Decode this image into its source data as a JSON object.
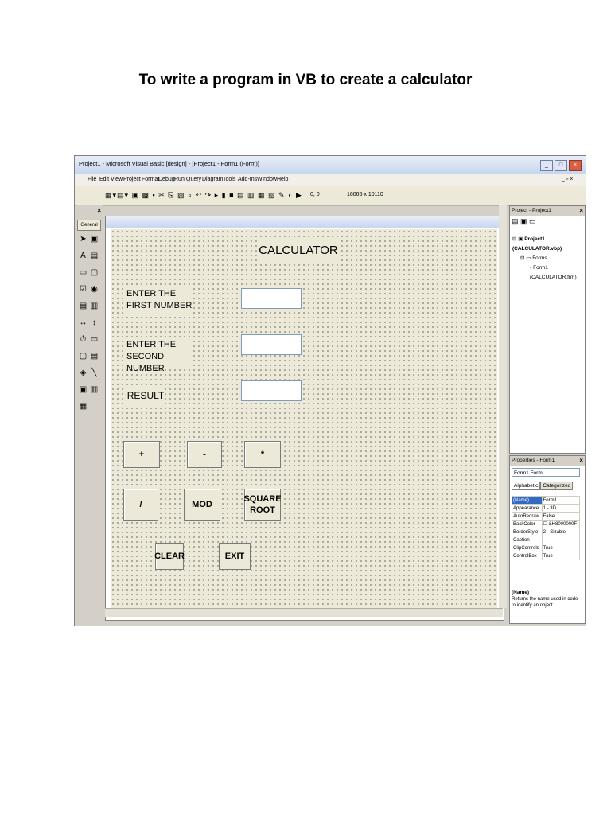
{
  "document": {
    "title": "To write a program in VB to create a calculator"
  },
  "window": {
    "title": "Project1 - Microsoft Visual Basic [design] - [Project1 - Form1 (Form)]",
    "menu": [
      "File",
      "Edit",
      "View",
      "Project",
      "Format",
      "Debug",
      "Run",
      "Query",
      "Diagram",
      "Tools",
      "Add-Ins",
      "Window",
      "Help"
    ],
    "toolbar_position": "0, 0",
    "toolbar_size": "16065 x 10110"
  },
  "toolbox": {
    "tab_label": "General"
  },
  "form": {
    "heading": "CALCULATOR",
    "label_first": "ENTER THE FIRST NUMBER",
    "label_second": "ENTER THE SECOND NUMBER",
    "label_result": "RESULT",
    "buttons": {
      "add": "+",
      "subtract": "-",
      "multiply": "*",
      "divide": "/",
      "mod": "MOD",
      "square_root": "SQUARE ROOT",
      "clear": "CLEAR",
      "exit": "EXIT"
    }
  },
  "project_explorer": {
    "title": "Project - Project1",
    "project_node": "Project1 (CALCULATOR.vbp)",
    "forms_node": "Forms",
    "form_node": "Form1 (CALCULATOR.frm)"
  },
  "properties": {
    "title": "Properties - Form1",
    "object": "Form1 Form",
    "tab_alphabetic": "Alphabetic",
    "tab_categorized": "Categorized",
    "rows": [
      {
        "name": "(Name)",
        "value": "Form1"
      },
      {
        "name": "Appearance",
        "value": "1 - 3D"
      },
      {
        "name": "AutoRedraw",
        "value": "False"
      },
      {
        "name": "BackColor",
        "value": "&H8000000F"
      },
      {
        "name": "BorderStyle",
        "value": "2 - Sizable"
      },
      {
        "name": "Caption",
        "value": ""
      },
      {
        "name": "ClipControls",
        "value": "True"
      },
      {
        "name": "ControlBox",
        "value": "True"
      }
    ],
    "desc_title": "(Name)",
    "desc_text": "Returns the name used in code to identify an object."
  }
}
